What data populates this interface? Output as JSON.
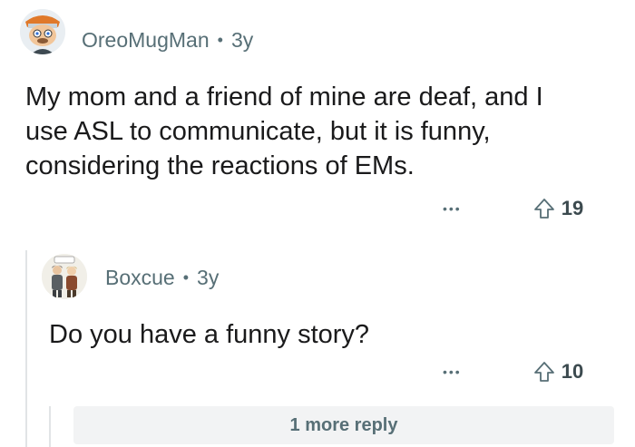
{
  "comment": {
    "author": "OreoMugMan",
    "separator": "•",
    "age": "3y",
    "text_lines": [
      "My mom and a friend of mine are deaf, and I",
      "use ASL to communicate, but it is funny,",
      "considering the reactions of EMs."
    ],
    "more_label": "•••",
    "vote_count": "19",
    "avatar_icon": "cartoon-avatar-icon",
    "upvote_icon": "upvote-arrow-icon"
  },
  "reply": {
    "author": "Boxcue",
    "separator": "•",
    "age": "3y",
    "text": "Do you have a funny story?",
    "more_label": "•••",
    "vote_count": "10",
    "avatar_icon": "comic-avatar-icon",
    "upvote_icon": "upvote-arrow-icon"
  },
  "more_replies_label": "1 more reply",
  "colors": {
    "text": "#1a1a1b",
    "meta": "#576f76",
    "thread_line": "#e1e4e6",
    "button_bg": "#f2f3f4"
  }
}
